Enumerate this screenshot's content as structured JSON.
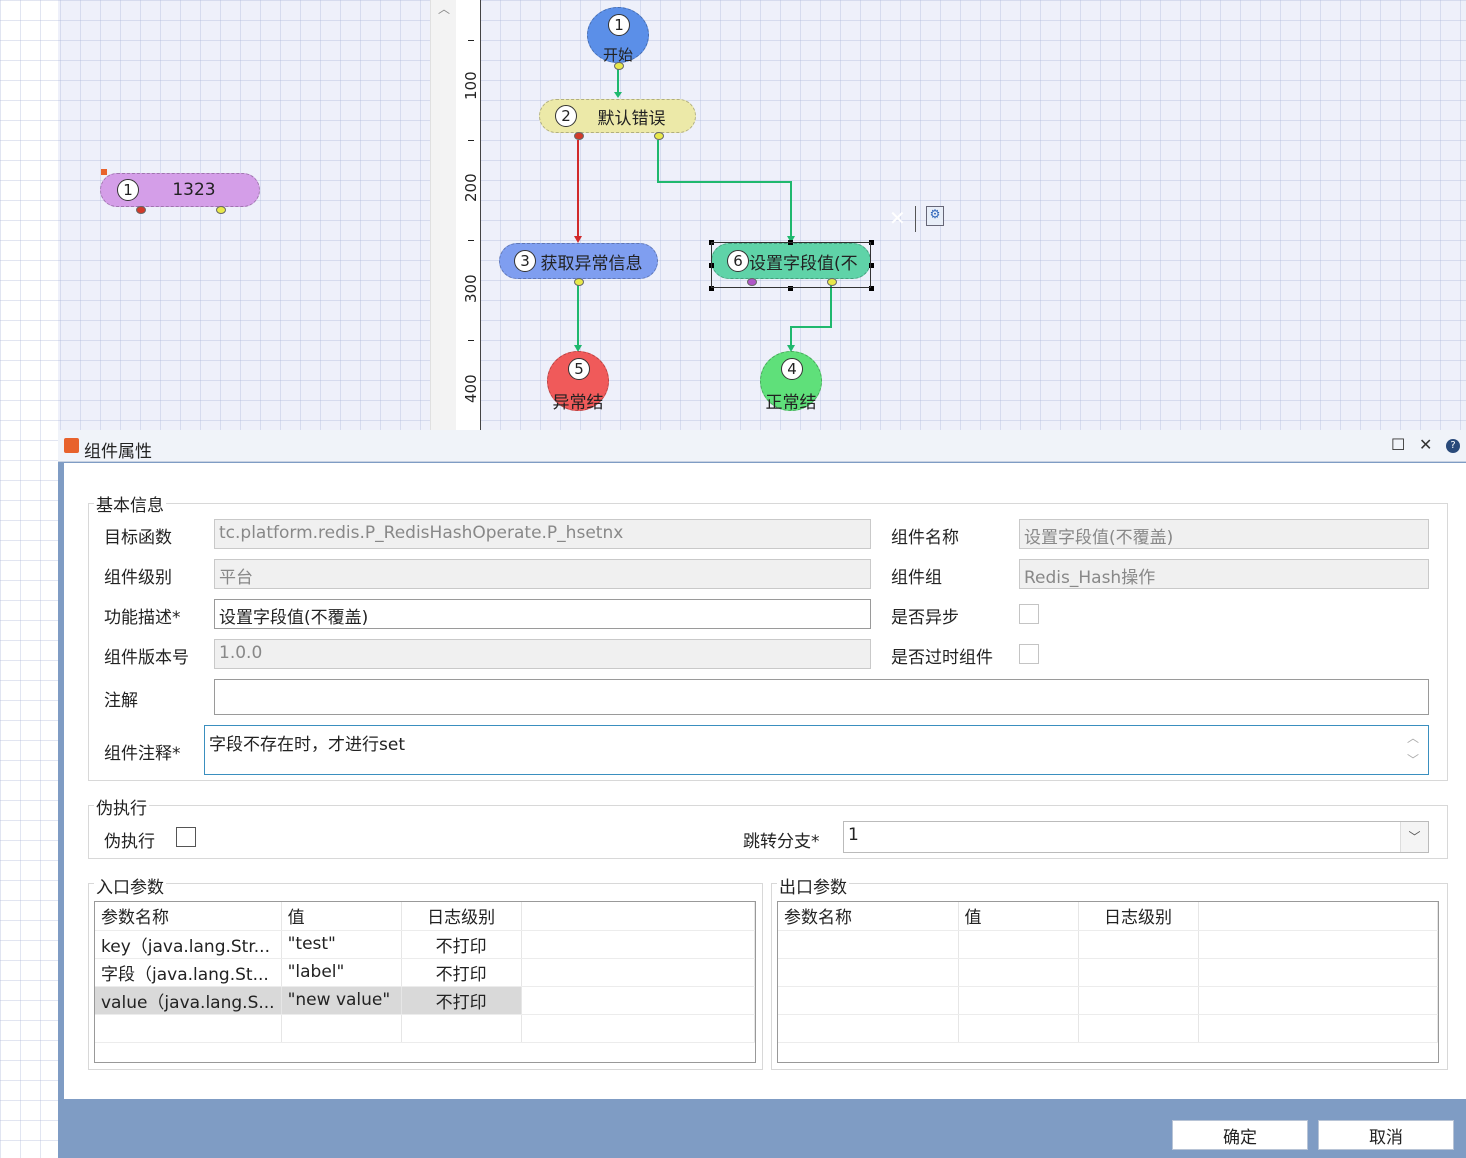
{
  "canvas": {
    "ruler_labels": [
      "100",
      "200",
      "300",
      "400"
    ],
    "nodes": [
      {
        "num": "1",
        "label": "开始",
        "color": "#5b8fe8"
      },
      {
        "num": "2",
        "label": "默认错误",
        "color": "#ece9a8"
      },
      {
        "num": "3",
        "label": "获取异常信息",
        "color": "#7f9ef0"
      },
      {
        "num": "6",
        "label": "设置字段值(不",
        "color": "#5fd3a8"
      },
      {
        "num": "5",
        "label": "异常结",
        "color": "#f05a5a"
      },
      {
        "num": "4",
        "label": "正常结",
        "color": "#5fe07a"
      },
      {
        "num": "1",
        "label": "1323",
        "color": "#d49ee8"
      }
    ],
    "connectors": {
      "error": "#d12a2a",
      "normal": "#1fb86e"
    }
  },
  "dialog": {
    "title": "组件属性",
    "basic_info": {
      "legend": "基本信息",
      "target_function": {
        "label": "目标函数",
        "value": "tc.platform.redis.P_RedisHashOperate.P_hsetnx"
      },
      "component_name": {
        "label": "组件名称",
        "value": "设置字段值(不覆盖)"
      },
      "component_level": {
        "label": "组件级别",
        "value": "平台"
      },
      "component_group": {
        "label": "组件组",
        "value": "Redis_Hash操作"
      },
      "description": {
        "label": "功能描述*",
        "value": "设置字段值(不覆盖)"
      },
      "is_async": {
        "label": "是否异步"
      },
      "version": {
        "label": "组件版本号",
        "value": "1.0.0"
      },
      "is_deprecated": {
        "label": "是否过时组件"
      },
      "annotation": {
        "label": "注解",
        "value": ""
      },
      "comment": {
        "label": "组件注释*",
        "value": "字段不存在时，才进行set"
      }
    },
    "pseudo": {
      "legend": "伪执行",
      "checkbox_label": "伪执行",
      "branch_label": "跳转分支*",
      "branch_value": "1"
    },
    "input_params": {
      "legend": "入口参数",
      "columns": [
        "参数名称",
        "值",
        "日志级别"
      ],
      "rows": [
        [
          "key（java.lang.Str...",
          "\"test\"",
          "不打印"
        ],
        [
          "字段（java.lang.St...",
          "\"label\"",
          "不打印"
        ],
        [
          "value（java.lang.S...",
          "\"new value\"",
          "不打印"
        ]
      ]
    },
    "output_params": {
      "legend": "出口参数",
      "columns": [
        "参数名称",
        "值",
        "日志级别"
      ]
    },
    "ok_label": "确定",
    "cancel_label": "取消"
  }
}
